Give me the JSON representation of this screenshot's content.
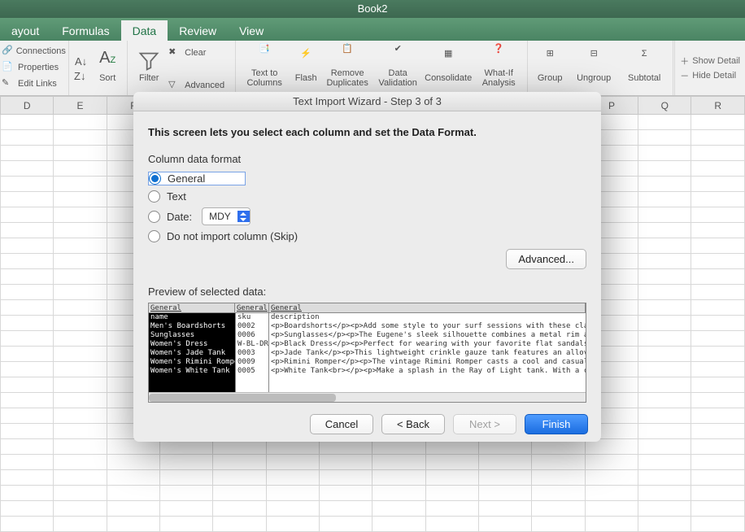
{
  "window": {
    "title": "Book2"
  },
  "ribbon": {
    "tabs": [
      "ayout",
      "Formulas",
      "Data",
      "Review",
      "View"
    ],
    "active_index": 2,
    "conn": {
      "a": "Connections",
      "b": "Properties",
      "c": "Edit Links"
    },
    "sort_label": "Sort",
    "filter_label": "Filter",
    "adv": {
      "clear": "Clear",
      "advanced": "Advanced"
    },
    "ttc": "Text to Columns",
    "flash": "Flash",
    "rd": "Remove Duplicates",
    "dv": "Data Validation",
    "cons": "Consolidate",
    "wi": "What-If Analysis",
    "grp": "Group",
    "ugrp": "Ungroup",
    "sub": "Subtotal",
    "sd": "Show Detail",
    "hd": "Hide Detail"
  },
  "columns": [
    "D",
    "E",
    "F",
    "",
    "",
    "",
    "",
    "",
    "",
    "",
    "",
    "P",
    "Q",
    "R"
  ],
  "dialog": {
    "title": "Text Import Wizard - Step 3 of 3",
    "intro": "This screen lets you select each column and set the Data Format.",
    "section": "Column data format",
    "opt_general": "General",
    "opt_text": "Text",
    "opt_date": "Date:",
    "date_value": "MDY",
    "opt_skip": "Do not import column (Skip)",
    "advanced": "Advanced...",
    "preview_label": "Preview of selected data:",
    "headers": [
      "General",
      "General",
      "General"
    ],
    "col0": [
      "name",
      "Men's Boardshorts",
      "Sunglasses",
      "Women's Dress",
      "Women's Jade Tank",
      "Women's Rimini Romper",
      "Women's White Tank"
    ],
    "col1": [
      "sku",
      "0002",
      "0006",
      "W-BL-DR",
      "0003",
      "0009",
      "0005"
    ],
    "col2": [
      "description",
      "<p>Boardshorts</p><p>Add some style to your surf sessions with these classic ",
      "<p>Sunglasses</p><p>The Eugene's sleek silhouette combines a metal rim and br",
      "<p>Black Dress</p><p>Perfect for wearing with your favorite flat sandals or t",
      "<p>Jade Tank</p><p>This lightweight crinkle gauze tank features an allover fl",
      "<p>Rimini Romper</p><p>The vintage Rimini Romper casts a cool and casual vibe",
      "<p>White Tank<br></p><p>Make a splash in the Ray of Light tank. With a croppe"
    ],
    "buttons": {
      "cancel": "Cancel",
      "back": "< Back",
      "next": "Next >",
      "finish": "Finish"
    }
  }
}
